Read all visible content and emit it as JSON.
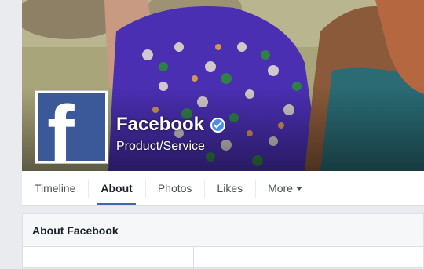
{
  "page": {
    "name": "Facebook",
    "category": "Product/Service",
    "verified": true,
    "brand_color": "#3b5998",
    "verified_color": "#4a90e2"
  },
  "nav": {
    "tabs": [
      {
        "label": "Timeline",
        "active": false
      },
      {
        "label": "About",
        "active": true
      },
      {
        "label": "Photos",
        "active": false
      },
      {
        "label": "Likes",
        "active": false
      },
      {
        "label": "More",
        "active": false,
        "has_dropdown": true
      }
    ],
    "active_indicator_color": "#4267b2"
  },
  "about": {
    "title": "About Facebook"
  },
  "icons": {
    "profile": "facebook-f-logo",
    "verified": "verified-check-icon",
    "dropdown": "caret-down-icon"
  }
}
